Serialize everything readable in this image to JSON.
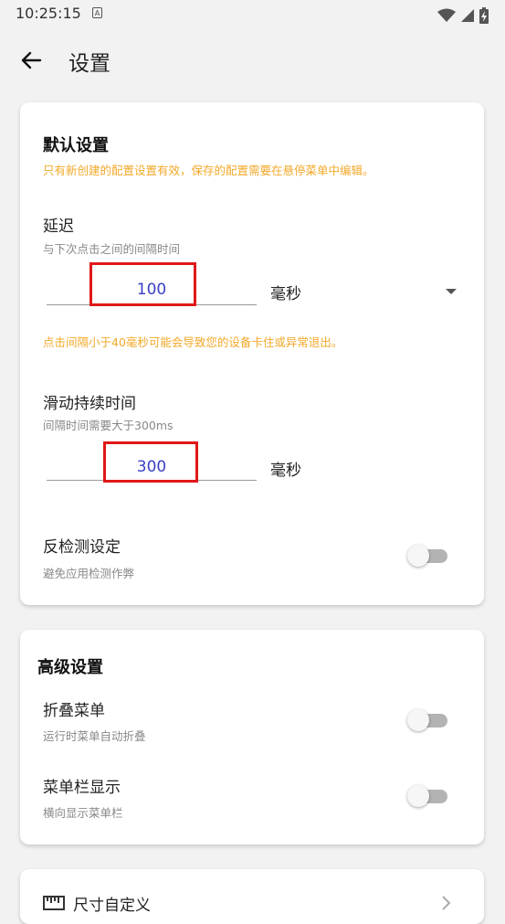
{
  "status_bar": {
    "time": "10:25:15",
    "badge": "A"
  },
  "app_bar": {
    "title": "设置"
  },
  "default_settings": {
    "title": "默认设置",
    "note": "只有新创建的配置设置有效，保存的配置需要在悬停菜单中编辑。",
    "delay": {
      "label": "延迟",
      "description": "与下次点击之间的间隔时间",
      "value": "100",
      "unit": "毫秒",
      "warning": "点击间隔小于40毫秒可能会导致您的设备卡住或异常退出。"
    },
    "swipe_duration": {
      "label": "滑动持续时间",
      "description": "间隔时间需要大于300ms",
      "value": "300",
      "unit": "毫秒"
    },
    "anti_detection": {
      "label": "反检测设定",
      "description": "避免应用检测作弊",
      "enabled": false
    }
  },
  "advanced_settings": {
    "title": "高级设置",
    "collapse_menu": {
      "label": "折叠菜单",
      "description": "运行时菜单自动折叠",
      "enabled": false
    },
    "menu_bar_display": {
      "label": "菜单栏显示",
      "description": "横向显示菜单栏",
      "enabled": false
    }
  },
  "bottom_card": {
    "item_label": "尺寸自定义"
  },
  "colors": {
    "accent": "#3a40c4",
    "warning": "#f2a92a",
    "highlight": "#e01818"
  }
}
